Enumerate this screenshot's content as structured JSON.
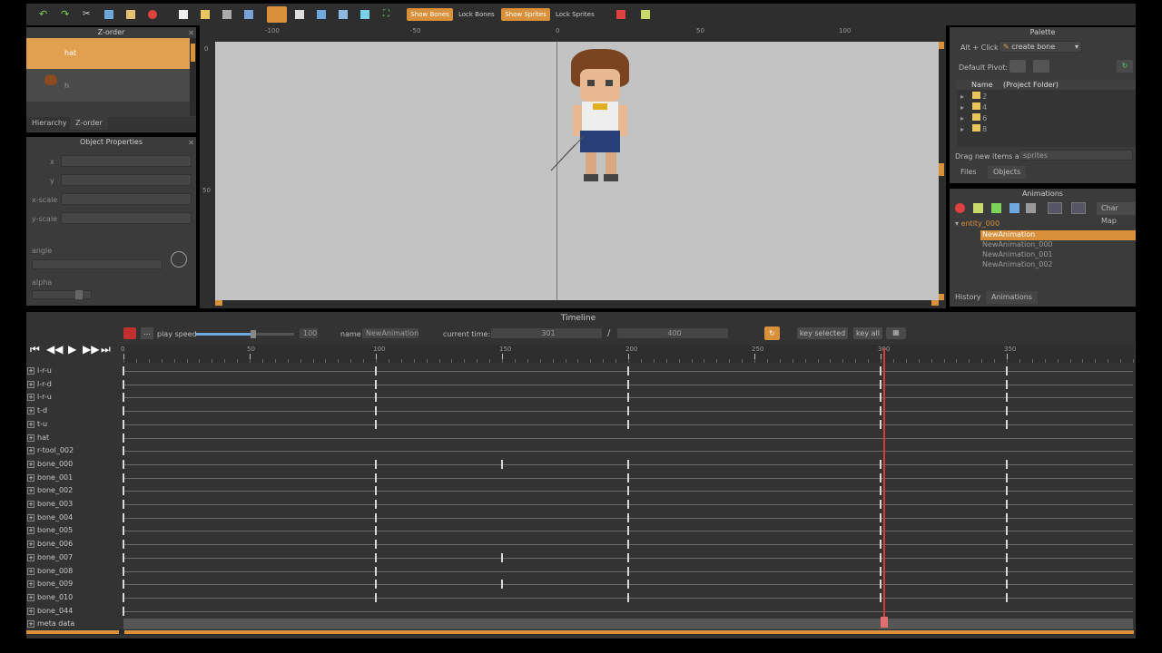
{
  "toolbar": {
    "show_bones": "Show Bones",
    "lock_bones": "Lock Bones",
    "show_sprites": "Show Sprites",
    "lock_sprites": "Lock Sprites"
  },
  "zorder": {
    "title": "Z-order",
    "items": [
      {
        "label": "hat",
        "selected": true
      },
      {
        "label": "h",
        "selected": false
      }
    ],
    "tabs": [
      "Hierarchy",
      "Z-order"
    ]
  },
  "object_properties": {
    "title": "Object Properties",
    "fields": [
      "x",
      "y",
      "x-scale",
      "y-scale"
    ],
    "angle_label": "angle",
    "alpha_label": "alpha"
  },
  "canvas": {
    "ruler_top": [
      "-100",
      "-50",
      "0",
      "50",
      "100"
    ],
    "ruler_left": [
      "0",
      "50"
    ],
    "background_color": "#c3c3c3"
  },
  "palette": {
    "title": "Palette",
    "alt_click_label": "Alt + Click:",
    "alt_click_value": "create bone",
    "default_pivot_label": "Default Pivot:",
    "col_name": "Name",
    "col_folder": "(Project Folder)",
    "folders": [
      "2",
      "4",
      "6",
      "8"
    ],
    "drag_label": "Drag new items as",
    "drag_value": "sprites",
    "tabs": [
      "Files",
      "Objects"
    ]
  },
  "animations": {
    "title": "Animations",
    "char_map": "Char Map",
    "entity": "entity_000",
    "list": [
      {
        "label": "NewAnimation",
        "selected": true
      },
      {
        "label": "NewAnimation_000",
        "selected": false
      },
      {
        "label": "NewAnimation_001",
        "selected": false
      },
      {
        "label": "NewAnimation_002",
        "selected": false
      }
    ],
    "tabs": [
      "History",
      "Animations"
    ]
  },
  "timeline": {
    "title": "Timeline",
    "play_speed_label": "play speed",
    "play_speed_value": "100",
    "name_label": "name",
    "name_value": "NewAnimation",
    "current_time_label": "current time:",
    "current_time": "301",
    "separator": "/",
    "total_time": "400",
    "key_selected": "key selected",
    "key_all": "key all",
    "ruler": [
      "0",
      "50",
      "100",
      "150",
      "200",
      "250",
      "300",
      "350"
    ],
    "max_time": 400,
    "playhead_time": 301,
    "tracks": [
      {
        "name": "l-r-u",
        "keys": [
          0,
          100,
          200,
          300,
          350
        ]
      },
      {
        "name": "l-r-d",
        "keys": [
          0,
          100,
          200,
          300,
          350
        ]
      },
      {
        "name": "l-r-u",
        "keys": [
          0,
          100,
          200,
          300,
          350
        ]
      },
      {
        "name": "t-d",
        "keys": [
          0,
          100,
          200,
          300,
          350
        ]
      },
      {
        "name": "t-u",
        "keys": [
          0,
          100,
          200,
          300,
          350
        ]
      },
      {
        "name": "hat",
        "keys": [
          0
        ]
      },
      {
        "name": "r-tool_002",
        "keys": [
          0
        ]
      },
      {
        "name": "bone_000",
        "keys": [
          0,
          100,
          150,
          200,
          300,
          350
        ]
      },
      {
        "name": "bone_001",
        "keys": [
          0,
          100,
          200,
          300,
          350
        ]
      },
      {
        "name": "bone_002",
        "keys": [
          0,
          100,
          200,
          300,
          350
        ]
      },
      {
        "name": "bone_003",
        "keys": [
          0,
          100,
          200,
          300,
          350
        ]
      },
      {
        "name": "bone_004",
        "keys": [
          0,
          100,
          200,
          300,
          350
        ]
      },
      {
        "name": "bone_005",
        "keys": [
          0,
          100,
          200,
          300,
          350
        ]
      },
      {
        "name": "bone_006",
        "keys": [
          0,
          100,
          200,
          300,
          350
        ]
      },
      {
        "name": "bone_007",
        "keys": [
          0,
          100,
          150,
          200,
          300,
          350
        ]
      },
      {
        "name": "bone_008",
        "keys": [
          0,
          100,
          200,
          300,
          350
        ]
      },
      {
        "name": "bone_009",
        "keys": [
          0,
          100,
          150,
          200,
          300,
          350
        ]
      },
      {
        "name": "bone_010",
        "keys": [
          0,
          100,
          200,
          300,
          350
        ]
      },
      {
        "name": "bone_044",
        "keys": [
          0
        ]
      },
      {
        "name": "meta data",
        "keys": []
      }
    ]
  },
  "colors": {
    "accent": "#d9903a",
    "playhead": "#d83a3a",
    "selected_row": "#e0a050"
  }
}
